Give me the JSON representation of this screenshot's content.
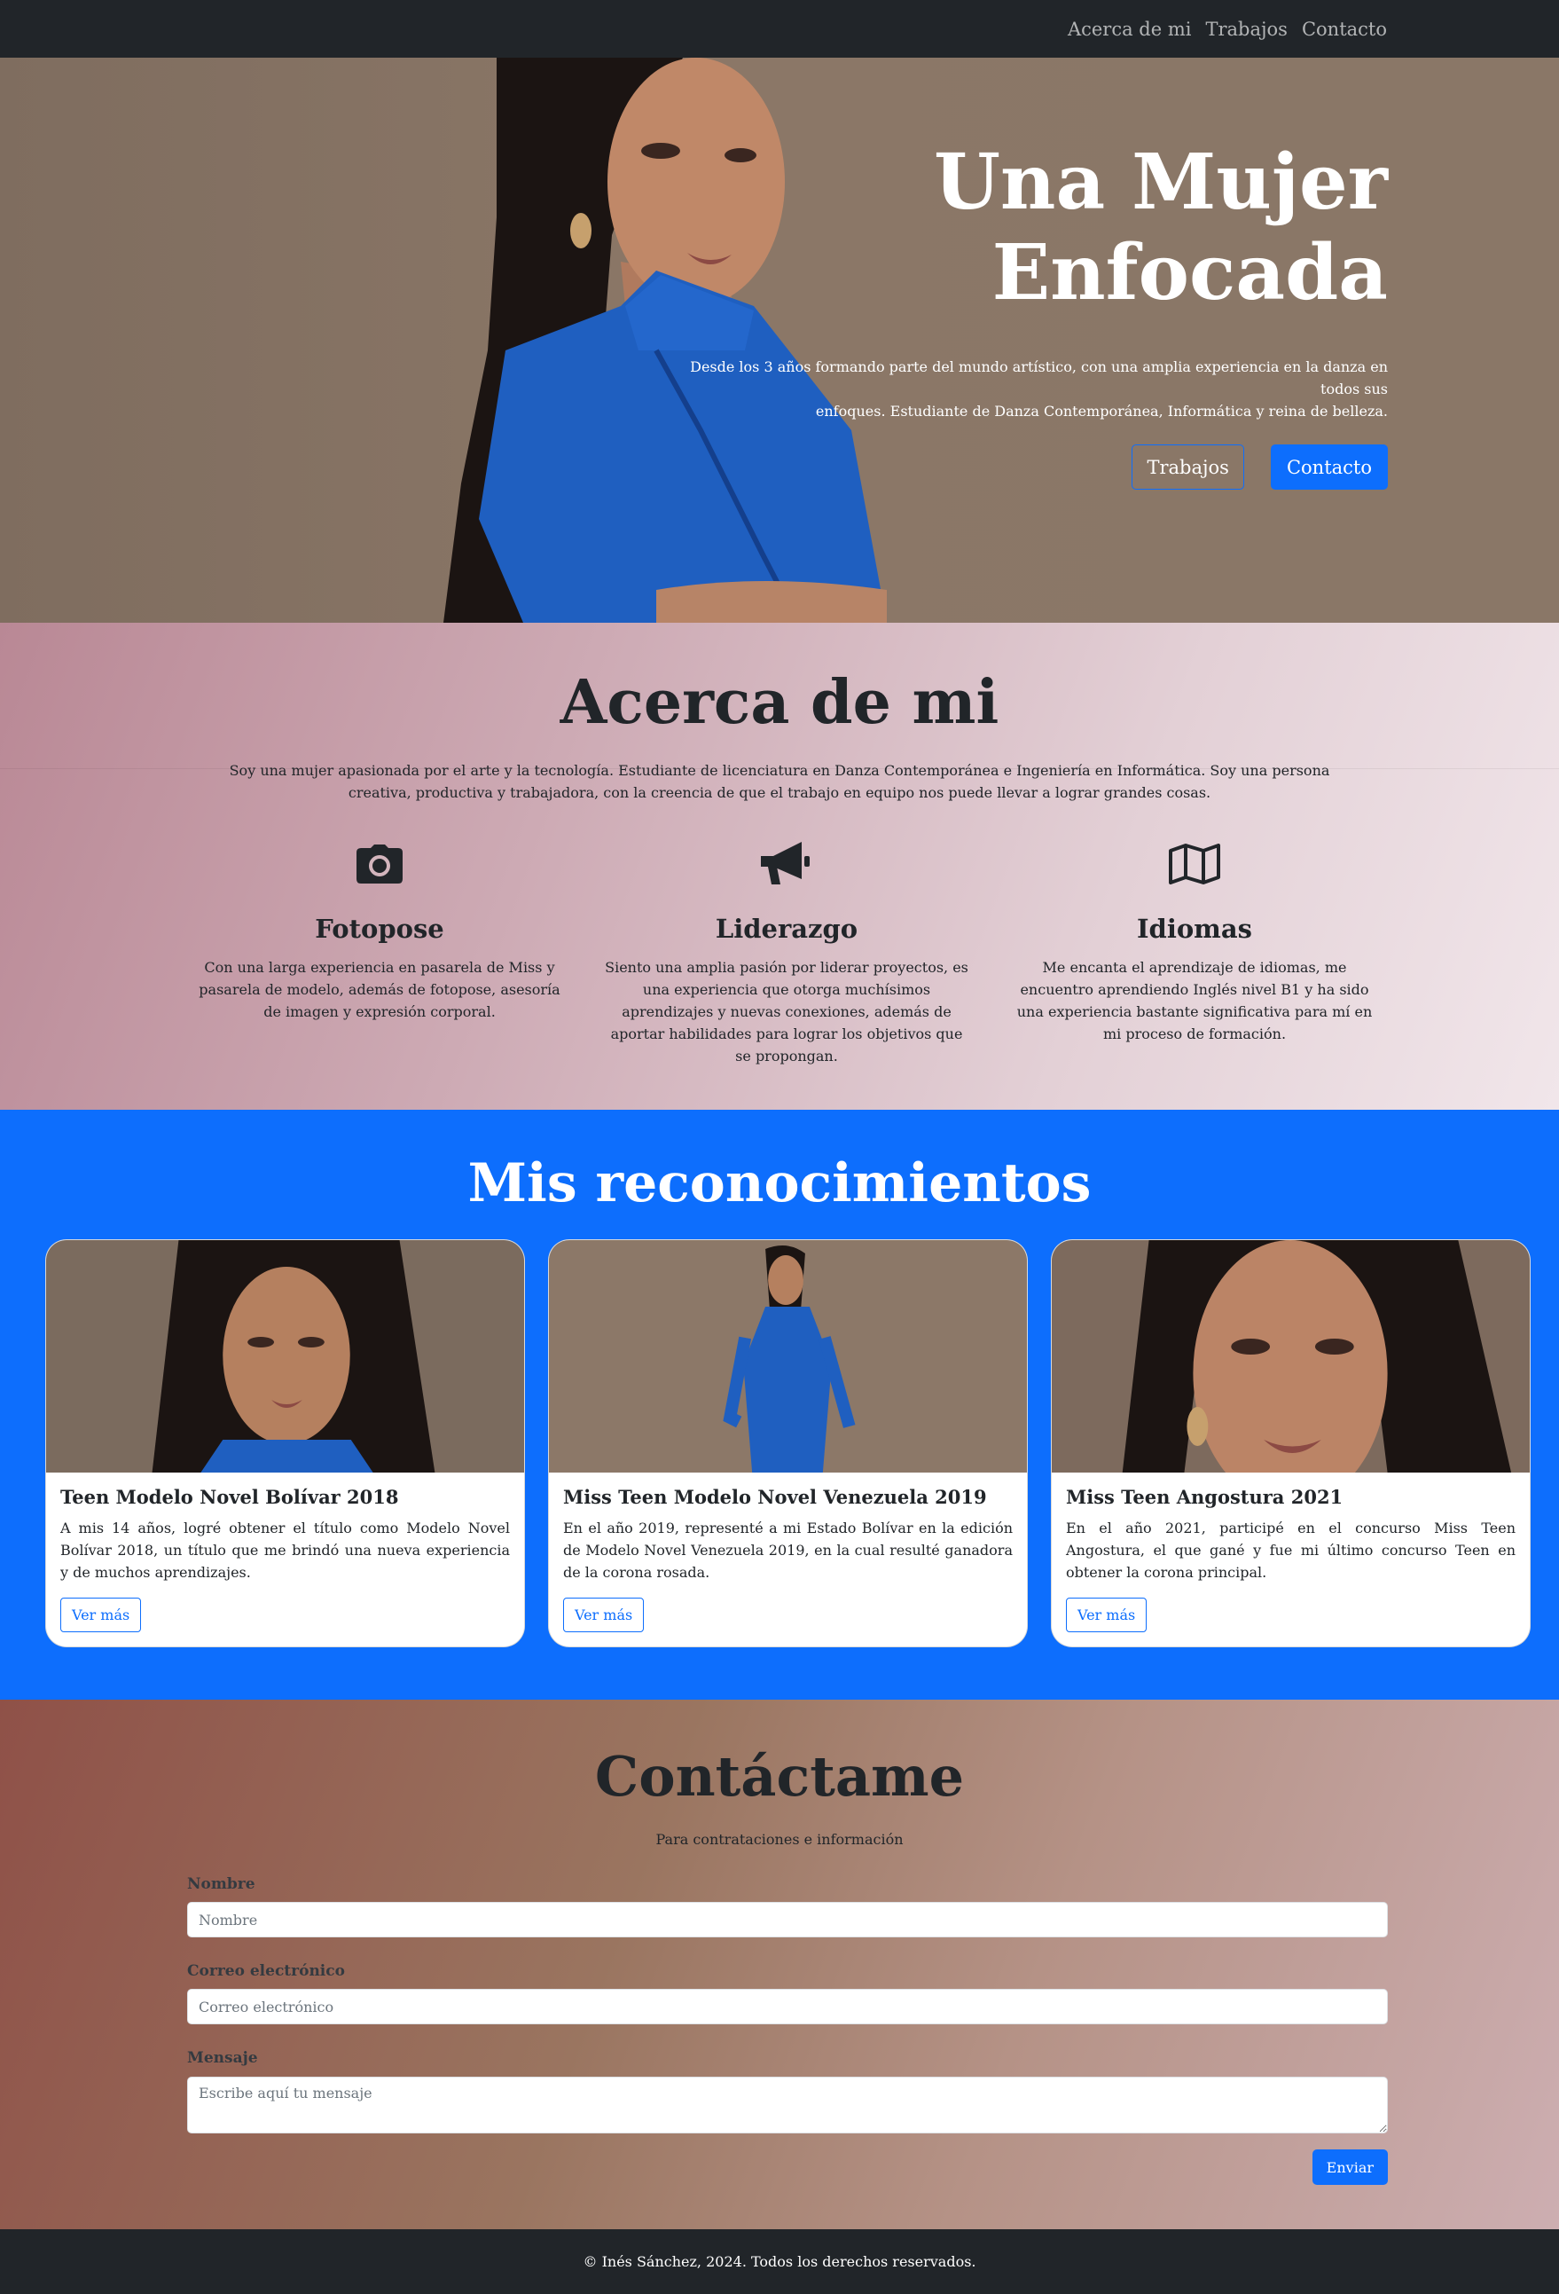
{
  "nav": {
    "links": [
      "Acerca de mi",
      "Trabajos",
      "Contacto"
    ]
  },
  "hero": {
    "title_line1": "Una Mujer",
    "title_line2": "Enfocada",
    "text_line1": "Desde los 3 años formando parte del mundo artístico, con una amplia experiencia en la danza en todos sus",
    "text_line2": "enfoques. Estudiante de Danza Contemporánea, Informática y reina de belleza.",
    "btn_works": "Trabajos",
    "btn_contact": "Contacto"
  },
  "about": {
    "title": "Acerca de mi",
    "text": "Soy una mujer apasionada por el arte y la tecnología. Estudiante de licenciatura en Danza Contemporánea e Ingeniería en Informática. Soy una persona creativa, productiva y trabajadora, con la creencia de que el trabajo en equipo nos puede llevar a lograr grandes cosas.",
    "features": [
      {
        "icon": "camera-icon",
        "title": "Fotopose",
        "text": "Con una larga experiencia en pasarela de Miss y pasarela de modelo, además de fotopose, asesoría de imagen y expresión corporal."
      },
      {
        "icon": "megaphone-icon",
        "title": "Liderazgo",
        "text": "Siento una amplia pasión por liderar proyectos, es una experiencia que otorga muchísimos aprendizajes y nuevas conexiones, además de aportar habilidades para lograr los objetivos que se propongan."
      },
      {
        "icon": "map-icon",
        "title": "Idiomas",
        "text": "Me encanta el aprendizaje de idiomas, me encuentro aprendiendo Inglés nivel B1 y ha sido una experiencia bastante significativa para mí en mi proceso de formación."
      }
    ]
  },
  "recognitions": {
    "title": "Mis reconocimientos",
    "cards": [
      {
        "title": "Teen Modelo Novel Bolívar 2018",
        "text": "A mis 14 años, logré obtener el título como Modelo Novel Bolívar 2018, un título que me brindó una nueva experiencia y de muchos aprendizajes.",
        "button": "Ver más"
      },
      {
        "title": "Miss Teen Modelo Novel Venezuela 2019",
        "text": "En el año 2019, representé a mi Estado Bolívar en la edición de Modelo Novel Venezuela 2019, en la cual resulté ganadora de la corona rosada.",
        "button": "Ver más"
      },
      {
        "title": "Miss Teen Angostura 2021",
        "text": "En el año 2021, participé en el concurso Miss Teen Angostura, el que gané y fue mi último concurso Teen en obtener la corona principal.",
        "button": "Ver más"
      }
    ]
  },
  "contact": {
    "title": "Contáctame",
    "subtitle": "Para contrataciones e información",
    "name_label": "Nombre",
    "name_placeholder": "Nombre",
    "email_label": "Correo electrónico",
    "email_placeholder": "Correo electrónico",
    "message_label": "Mensaje",
    "message_placeholder": "Escribe aquí tu mensaje",
    "submit": "Enviar"
  },
  "footer": {
    "text": "© Inés Sánchez, 2024. Todos los derechos reservados."
  },
  "colors": {
    "navbar": "#212529",
    "primary": "#0d6efd",
    "hero_bg": "#8a7566",
    "about_from": "#b98895",
    "about_to": "#f1e6ea",
    "contact_from": "#8f5148",
    "contact_to": "#cdaeb1"
  }
}
